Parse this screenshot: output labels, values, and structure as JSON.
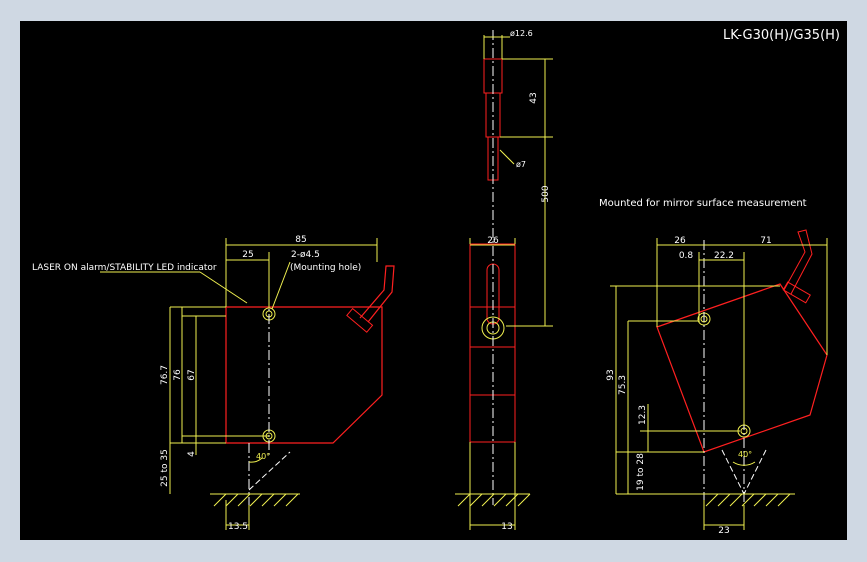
{
  "title": "LK-G30(H)/G35(H)",
  "labels": {
    "laser_led": "LASER ON alarm/STABILITY LED indicator",
    "mounting_holes": "2-ø4.5",
    "mounting_holes_note": "(Mounting hole)",
    "mirror_mount": "Mounted for mirror surface measurement"
  },
  "dims": {
    "front": {
      "d85": "85",
      "d25": "25",
      "d76_7": "76.7",
      "d76": "76",
      "d67": "67",
      "d4": "4",
      "d25to35": "25 to 35",
      "d13_5": "13.5",
      "angle": "40°"
    },
    "side": {
      "d12_6": "ø12.6",
      "d43": "43",
      "d7": "ø7",
      "d500": "500",
      "d26": "26",
      "d13": "13"
    },
    "mirror": {
      "d26": "26",
      "d71": "71",
      "d0_8": "0.8",
      "d22_2": "22.2",
      "d93": "93",
      "d75_3": "75.3",
      "d12_3": "12.3",
      "d19to28": "19 to 28",
      "d23": "23",
      "angle": "40°"
    }
  },
  "colors": {
    "background": "#000000",
    "frame": "#cfd8e3",
    "body_outline": "#ff2020",
    "dimension": "#f0f050",
    "center_line": "#ffffff"
  }
}
